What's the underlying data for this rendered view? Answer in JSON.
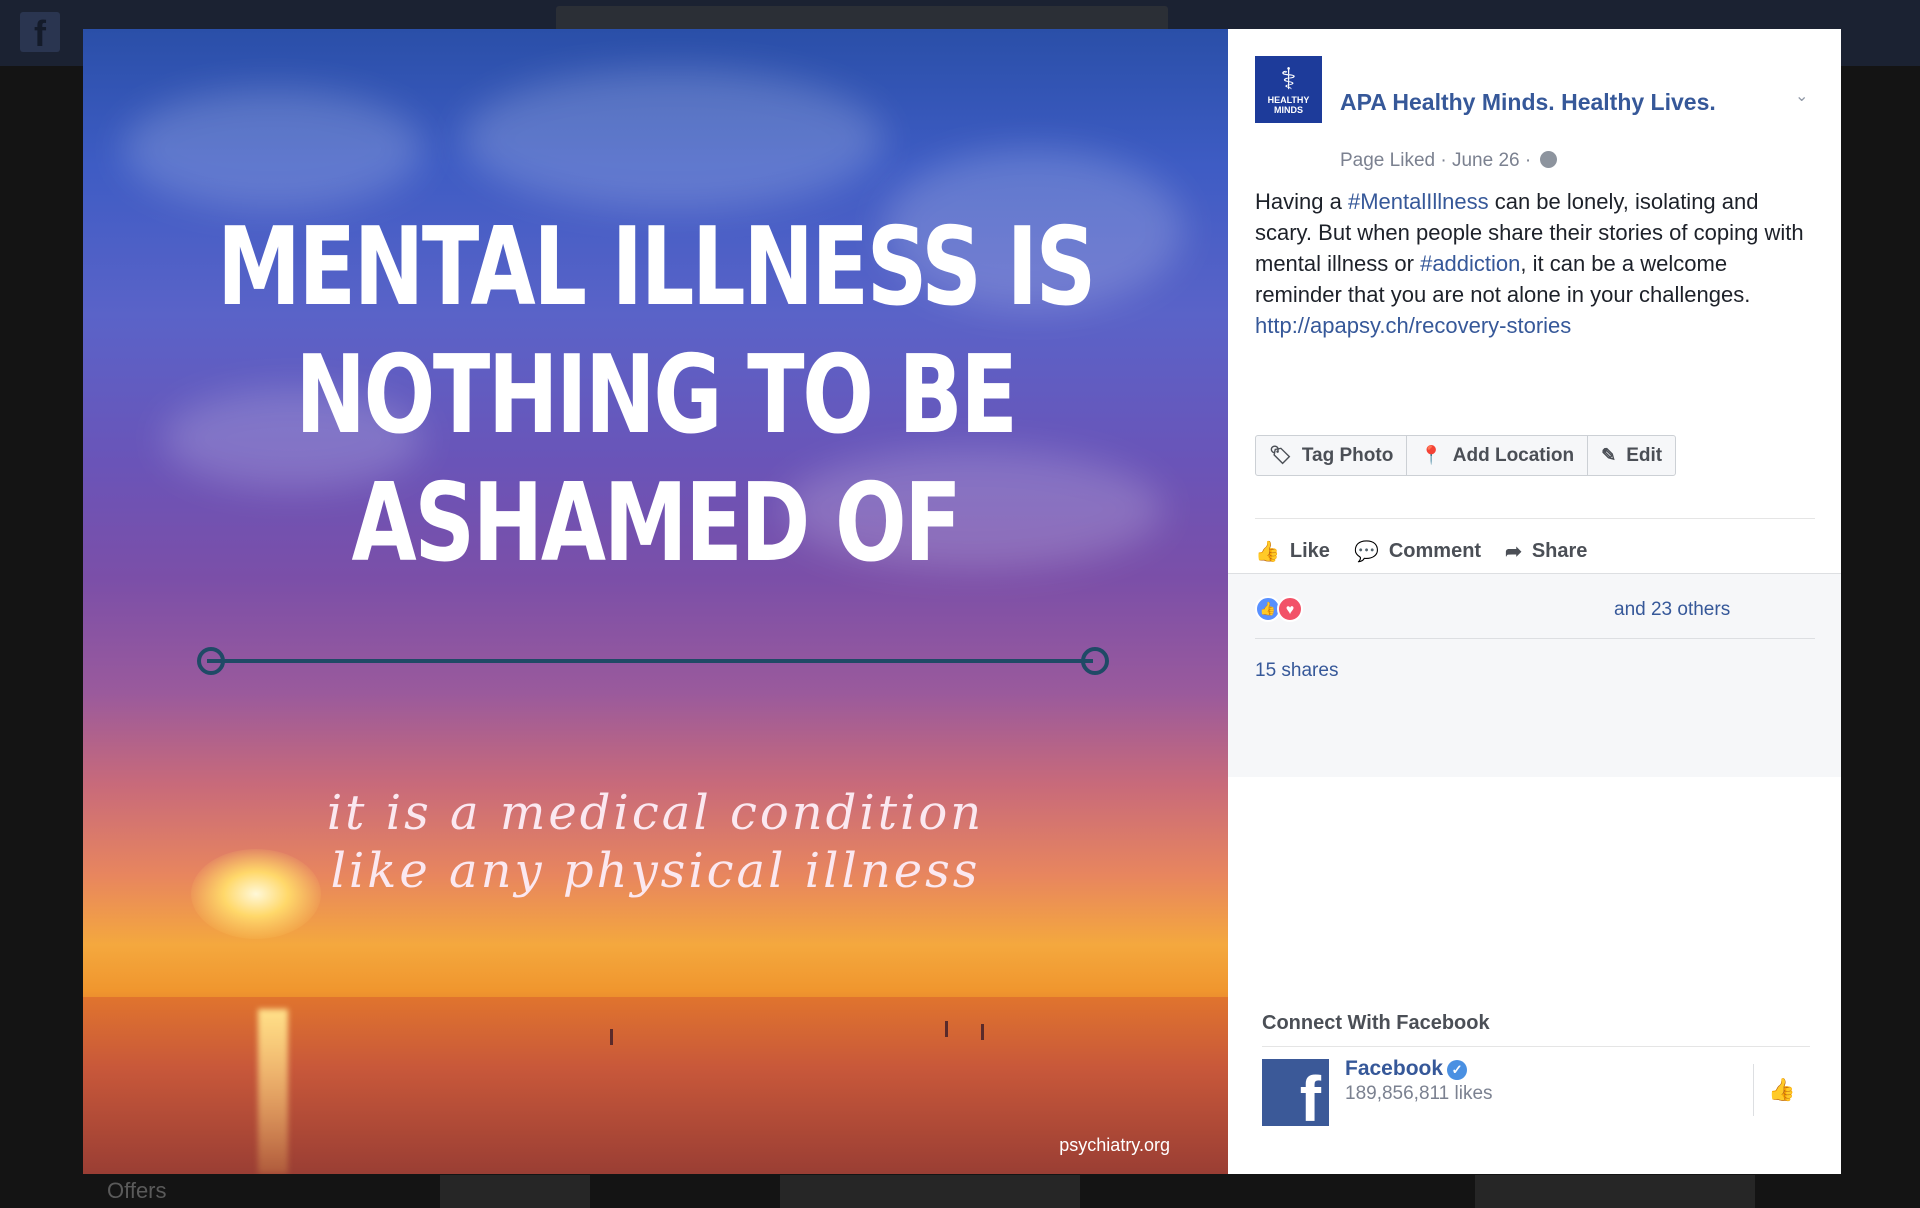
{
  "photo": {
    "headline": [
      "MENTAL ILLNESS IS",
      "NOTHING TO BE",
      "ASHAMED OF"
    ],
    "subtitle": [
      "it is a medical condition",
      "like any physical illness"
    ],
    "watermark": "psychiatry.org"
  },
  "post": {
    "page_name": "APA Healthy Minds. Healthy Lives.",
    "avatar_caption": "HEALTHY MINDS",
    "meta": "Page Liked · June 26 ·",
    "text_parts": {
      "p1": "Having a ",
      "tag1": "#MentalIllness",
      "p2": " can be lonely, isolating and scary. But when people share their stories of coping with mental illness or ",
      "tag2": "#addiction",
      "p3": ", it can be a welcome reminder that you are not alone in your challenges. ",
      "link": "http://apapsy.ch/recovery-stories"
    }
  },
  "photo_buttons": {
    "tag": "Tag Photo",
    "location": "Add Location",
    "edit": "Edit"
  },
  "actions": {
    "like": "Like",
    "comment": "Comment",
    "share": "Share"
  },
  "stats": {
    "others": "and 23 others",
    "shares": "15 shares"
  },
  "connect": {
    "title": "Connect With Facebook",
    "name": "Facebook",
    "likes": "189,856,811 likes"
  },
  "background": {
    "offers": "Offers"
  },
  "colors": {
    "link": "#365899",
    "brand": "#3b5998",
    "like_reaction": "#5890ff",
    "love_reaction": "#f25268"
  }
}
